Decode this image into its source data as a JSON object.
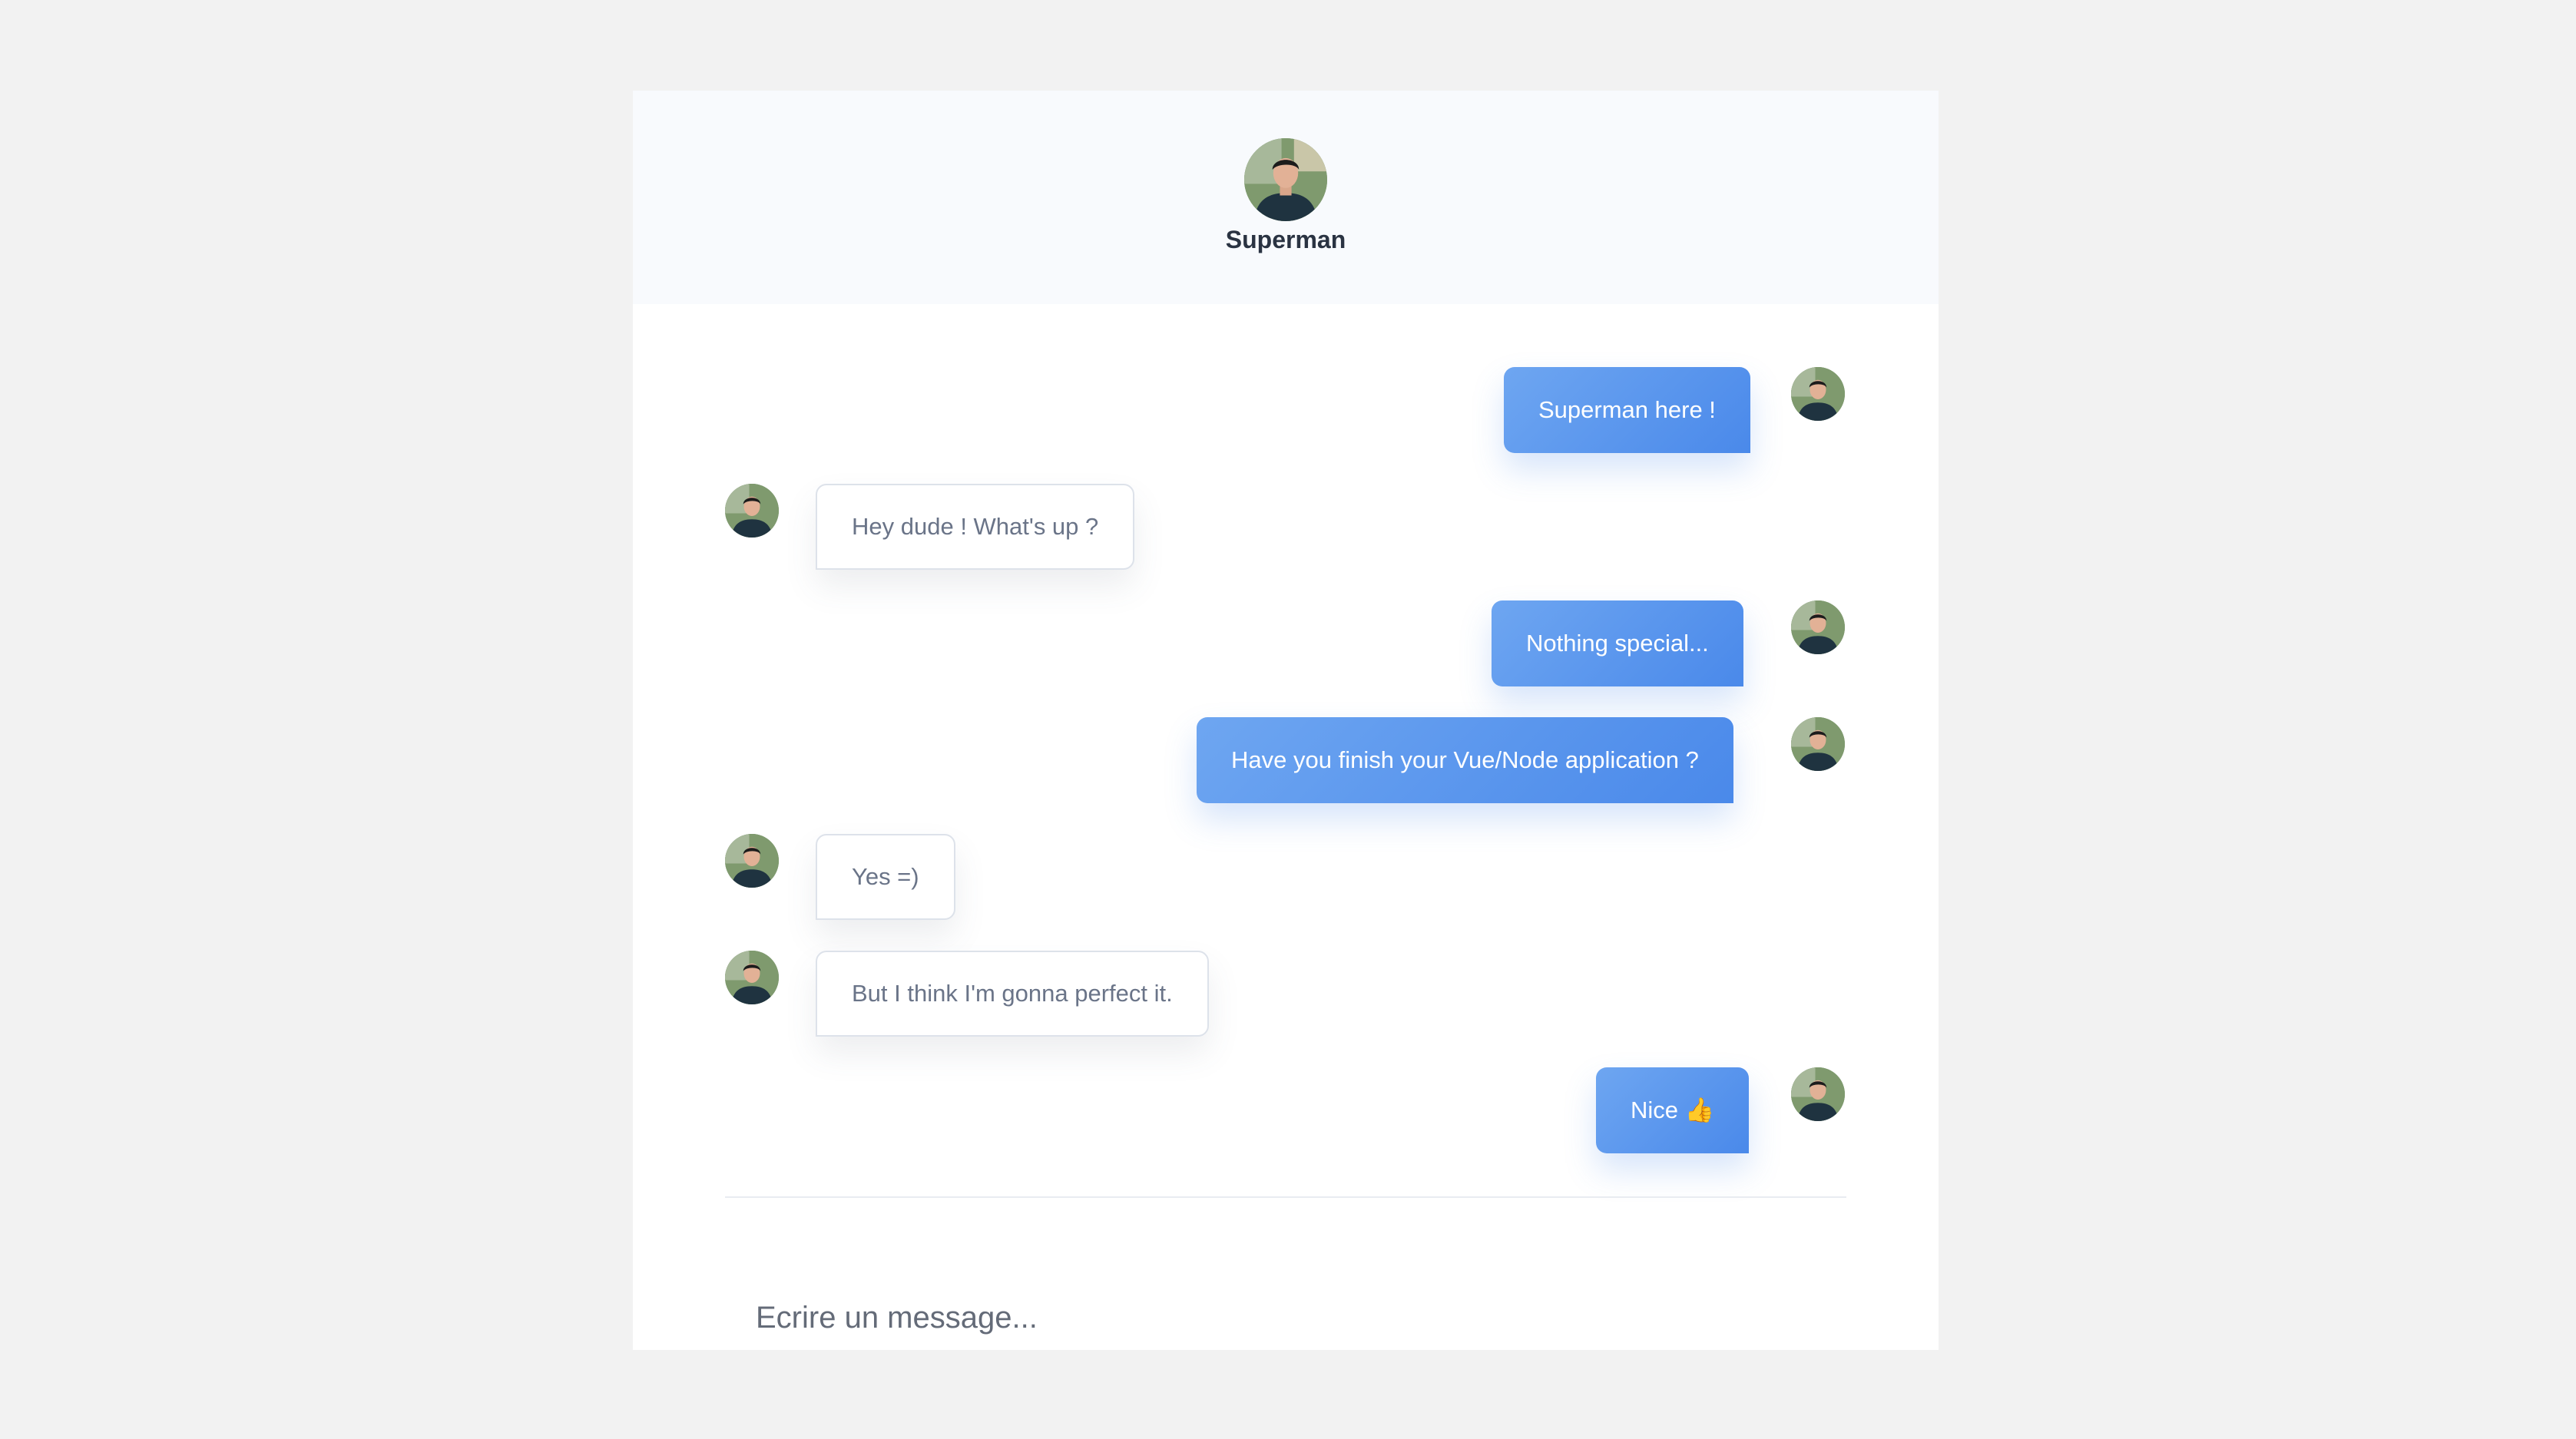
{
  "header": {
    "name": "Superman"
  },
  "messages": [
    {
      "side": "out",
      "text": "Superman here !"
    },
    {
      "side": "in",
      "text": "Hey dude ! What's up ?"
    },
    {
      "side": "out",
      "text": "Nothing special..."
    },
    {
      "side": "out",
      "text": "Have you finish your Vue/Node application ?"
    },
    {
      "side": "in",
      "text": "Yes =)"
    },
    {
      "side": "in",
      "text": "But I think I'm gonna perfect it."
    },
    {
      "side": "out",
      "text": "Nice",
      "emoji": "👍"
    }
  ],
  "composer": {
    "placeholder": "Ecrire un message..."
  },
  "colors": {
    "page_bg": "#f2f2f2",
    "header_bg": "#f8fafd",
    "outgoing_bubble": "#5b97ee",
    "incoming_text": "#6a7488"
  },
  "icons": {
    "avatar": "user-avatar",
    "reaction": "thumbs-up-emoji"
  }
}
